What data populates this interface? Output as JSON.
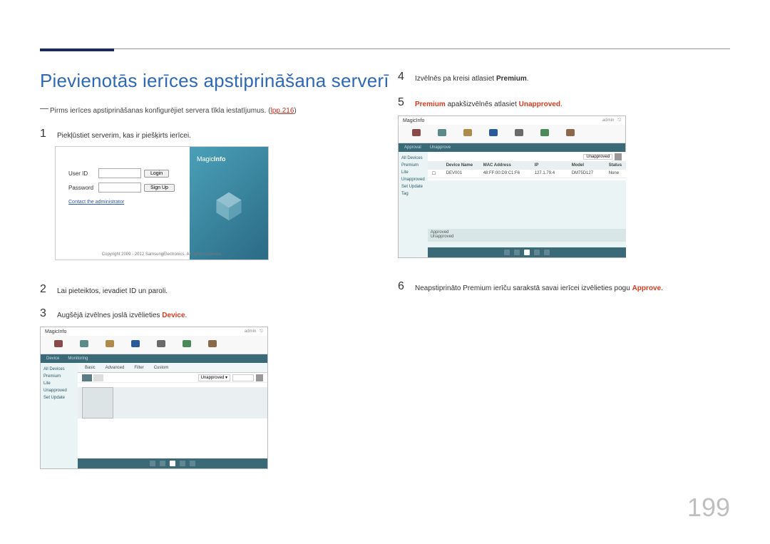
{
  "page_title": "Pievienotās ierīces apstiprināšana serverī",
  "note_text": "Pirms ierīces apstiprināšanas konfigurējiet servera tīkla iestatījumus. (",
  "note_link": "lpp.216",
  "note_close": ")",
  "steps": {
    "1": "Piekļūstiet serverim, kas ir piešķirts ierīcei.",
    "2": "Lai pieteiktos, ievadiet ID un paroli.",
    "3_pre": "Augšējā izvēlnes joslā izvēlieties ",
    "3_hl": "Device",
    "3_post": ".",
    "4_pre": "Izvēlnēs pa kreisi atlasiet ",
    "4_hl": "Premium",
    "4_post": ".",
    "5_hl1": "Premium",
    "5_mid": " apakšizvēlnēs atlasiet ",
    "5_hl2": "Unapproved",
    "5_post": ".",
    "6_pre": "Neapstiprināto Premium ierīču sarakstā savai ierīcei izvēlieties pogu ",
    "6_hl": "Approve",
    "6_post": "."
  },
  "login": {
    "user_id_label": "User ID",
    "password_label": "Password",
    "login_btn": "Login",
    "signup_btn": "Sign Up",
    "contact_link": "Contact the administrator",
    "logo_pre": "Magic",
    "logo_post": "Info",
    "copyright": "Copyright 2009 - 2012 SamsungElectronics. All rights reserved."
  },
  "app": {
    "logo": "MagicInfo",
    "sidebar_items": [
      "All Devices",
      "Premium",
      "Lite",
      "Unapproved",
      "Set Update",
      "Tag"
    ],
    "tabs": [
      "Basic",
      "Advanced",
      "Filter",
      "Custom"
    ],
    "filter": "Unapproved",
    "table_header": [
      "",
      "Device Name",
      "MAC Address",
      "IP",
      "Model",
      "Status"
    ],
    "table_row": [
      "☐",
      "DEV001",
      "48:FF:00:D9:C1:F6",
      "127.1.79.4",
      "DM75D127",
      "None"
    ]
  },
  "page_number": "199"
}
